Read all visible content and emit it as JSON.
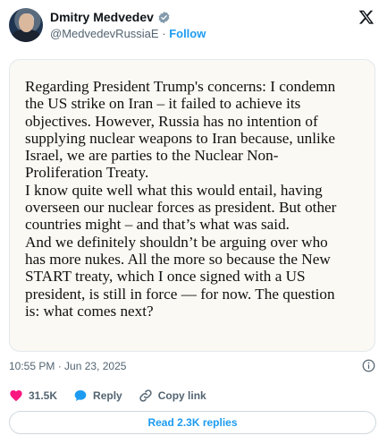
{
  "author": {
    "name": "Dmitry Medvedev",
    "handle": "@MedvedevRussiaE",
    "separator": "·",
    "follow_label": "Follow"
  },
  "icons": {
    "verified": "verified-badge-icon",
    "logo": "x-logo-icon",
    "info": "info-icon",
    "like": "heart-icon",
    "reply": "speech-bubble-icon",
    "copy": "link-icon"
  },
  "colors": {
    "accent": "#1d9bf0",
    "like": "#f91880",
    "muted": "#536471",
    "verified": "#829aab"
  },
  "media_text": "Regarding President Trump's concerns: I condemn\nthe US strike on Iran – it failed to achieve its\nobjectives. However, Russia has no intention of\nsupplying nuclear weapons to Iran because, unlike\nIsrael, we are parties to the Nuclear Non-\nProliferation Treaty.\nI know quite well what this would entail, having\noverseen our nuclear forces as president. But other\ncountries might – and that’s what was said.\nAnd we definitely shouldn’t be arguing over who\nhas more nukes. All the more so because the New\nSTART treaty, which I once signed with a US\npresident, is still in force — for now. The question\nis: what comes next?",
  "timestamp": "10:55 PM · Jun 23, 2025",
  "actions": {
    "likes": "31.5K",
    "reply_label": "Reply",
    "copy_label": "Copy link"
  },
  "read_replies_label": "Read 2.3K replies"
}
